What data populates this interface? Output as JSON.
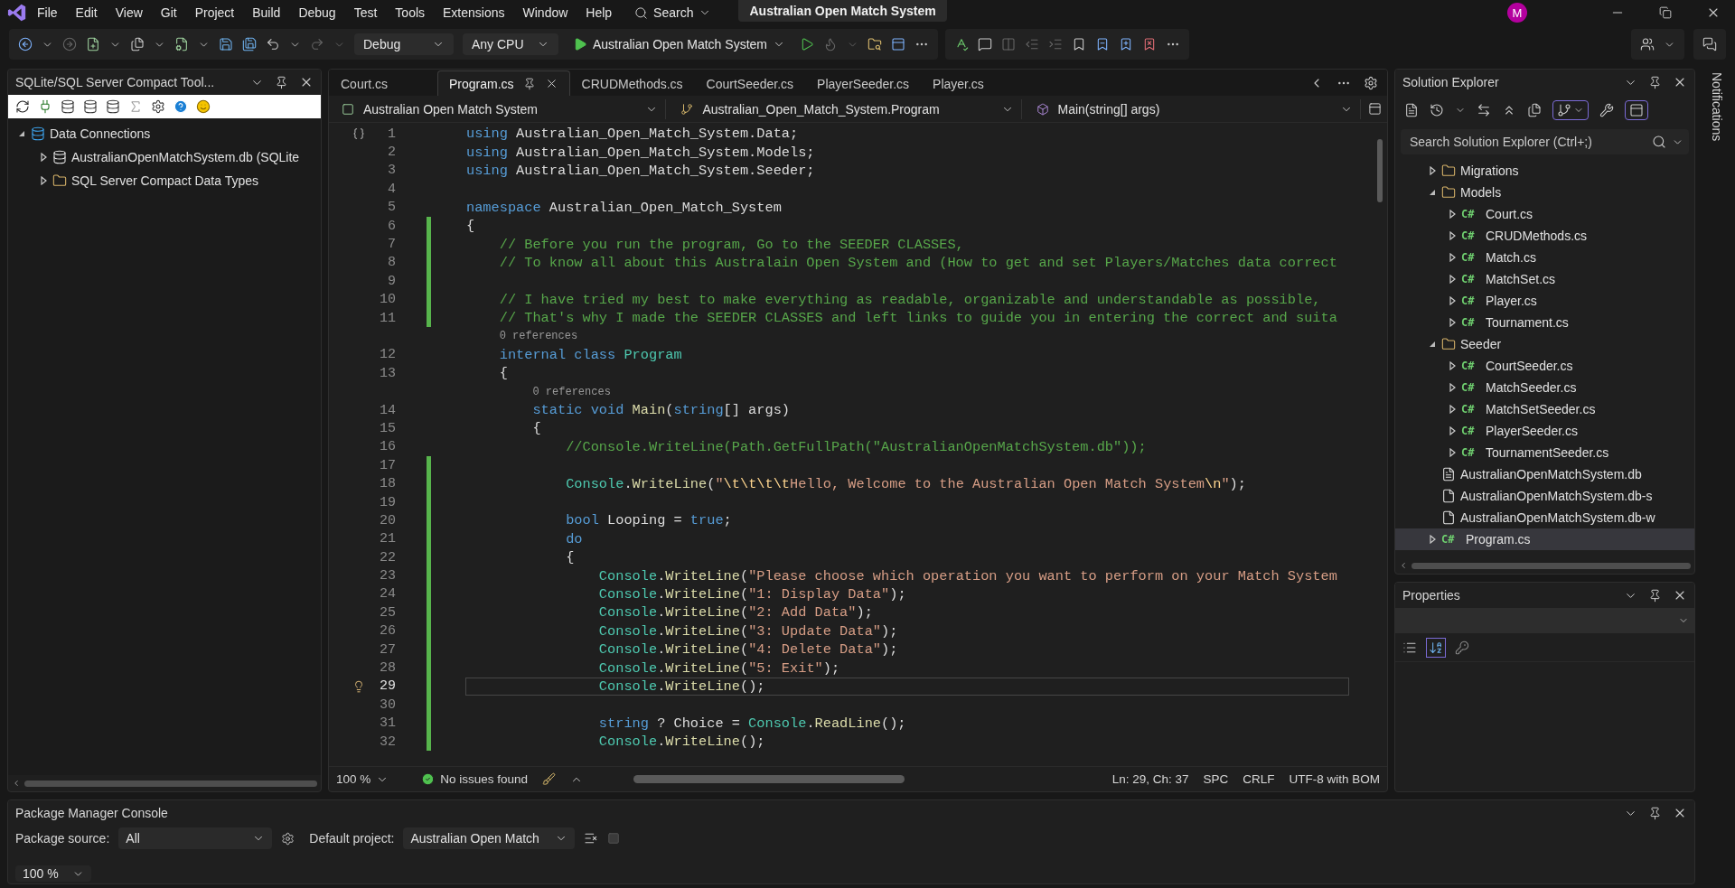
{
  "menu": {
    "items": [
      "File",
      "Edit",
      "View",
      "Git",
      "Project",
      "Build",
      "Debug",
      "Test",
      "Tools",
      "Extensions",
      "Window",
      "Help"
    ],
    "search": "Search",
    "title": "Australian Open Match System",
    "avatar": "M"
  },
  "toolbar": {
    "configuration": "Debug",
    "platform": "Any CPU",
    "startup": "Australian Open Match System"
  },
  "left_panel": {
    "title": "SQLite/SQL Server Compact Tool...",
    "tree": [
      {
        "label": "Data Connections",
        "kind": "connections",
        "expanded": true,
        "children": [
          {
            "label": "AustralianOpenMatchSystem.db (SQLite",
            "kind": "database",
            "expanded": false
          },
          {
            "label": "SQL Server Compact Data Types",
            "kind": "folder",
            "expanded": false
          }
        ]
      }
    ]
  },
  "editor": {
    "tabs": [
      {
        "label": "Court.cs",
        "selected": false
      },
      {
        "label": "Program.cs",
        "selected": true
      },
      {
        "label": "CRUDMethods.cs",
        "selected": false
      },
      {
        "label": "CourtSeeder.cs",
        "selected": false
      },
      {
        "label": "PlayerSeeder.cs",
        "selected": false
      },
      {
        "label": "Player.cs",
        "selected": false
      }
    ],
    "nav": [
      "Australian Open Match System",
      "Australian_Open_Match_System.Program",
      "Main(string[] args)"
    ],
    "lines": [
      {
        "kind": "code",
        "number": "1",
        "changed": false,
        "current": false,
        "tokens": [
          {
            "kind": "keyword",
            "text": "using "
          },
          {
            "kind": "plain",
            "text": "Australian_Open_Match_System.Data;"
          }
        ]
      },
      {
        "kind": "code",
        "number": "2",
        "changed": false,
        "current": false,
        "tokens": [
          {
            "kind": "keyword",
            "text": "using "
          },
          {
            "kind": "plain",
            "text": "Australian_Open_Match_System.Models;"
          }
        ]
      },
      {
        "kind": "code",
        "number": "3",
        "changed": false,
        "current": false,
        "tokens": [
          {
            "kind": "keyword",
            "text": "using "
          },
          {
            "kind": "plain",
            "text": "Australian_Open_Match_System.Seeder;"
          }
        ]
      },
      {
        "kind": "code",
        "number": "4",
        "changed": false,
        "current": false
      },
      {
        "kind": "code",
        "number": "5",
        "changed": false,
        "current": false,
        "tokens": [
          {
            "kind": "keyword",
            "text": "namespace "
          },
          {
            "kind": "plain",
            "text": "Australian_Open_Match_System"
          }
        ]
      },
      {
        "kind": "code",
        "number": "6",
        "changed": true,
        "current": false,
        "tokens": [
          {
            "kind": "plain",
            "text": "{"
          }
        ]
      },
      {
        "kind": "code",
        "number": "7",
        "changed": true,
        "current": false,
        "tokens": [
          {
            "kind": "comment",
            "text": "    // Before you run the program, Go to the SEEDER CLASSES,"
          }
        ]
      },
      {
        "kind": "code",
        "number": "8",
        "changed": true,
        "current": false,
        "tokens": [
          {
            "kind": "comment",
            "text": "    // To know all about this Australain Open System and (How to get and set Players/Matches data correct"
          }
        ]
      },
      {
        "kind": "code",
        "number": "9",
        "changed": true,
        "current": false
      },
      {
        "kind": "code",
        "number": "10",
        "changed": true,
        "current": false,
        "tokens": [
          {
            "kind": "comment",
            "text": "    // I have tried my best to make everything as readable, organizable and understandable as possible,"
          }
        ]
      },
      {
        "kind": "code",
        "number": "11",
        "changed": true,
        "current": false,
        "tokens": [
          {
            "kind": "comment",
            "text": "    // That's why I made the SEEDER CLASSES and left links to guide you in entering the correct and suita"
          }
        ]
      },
      {
        "kind": "lens",
        "text": "0 references"
      },
      {
        "kind": "code",
        "number": "12",
        "changed": false,
        "current": false,
        "tokens": [
          {
            "kind": "keyword",
            "text": "    internal class "
          },
          {
            "kind": "type",
            "text": "Program"
          }
        ]
      },
      {
        "kind": "code",
        "number": "13",
        "changed": false,
        "current": false,
        "tokens": [
          {
            "kind": "plain",
            "text": "    {"
          }
        ]
      },
      {
        "kind": "lens",
        "text": "0 references"
      },
      {
        "kind": "code",
        "number": "14",
        "changed": false,
        "current": false,
        "tokens": [
          {
            "kind": "keyword",
            "text": "        static void "
          },
          {
            "kind": "method",
            "text": "Main"
          },
          {
            "kind": "plain",
            "text": "("
          },
          {
            "kind": "keyword",
            "text": "string"
          },
          {
            "kind": "plain",
            "text": "[] args)"
          }
        ]
      },
      {
        "kind": "code",
        "number": "15",
        "changed": false,
        "current": false,
        "tokens": [
          {
            "kind": "plain",
            "text": "        {"
          }
        ]
      },
      {
        "kind": "code",
        "number": "16",
        "changed": false,
        "current": false,
        "tokens": [
          {
            "kind": "comment",
            "text": "            //Console.WriteLine(Path.GetFullPath(\"AustralianOpenMatchSystem.db\"));"
          }
        ]
      },
      {
        "kind": "code",
        "number": "17",
        "changed": true,
        "current": false
      },
      {
        "kind": "code",
        "number": "18",
        "changed": true,
        "current": false,
        "tokens": [
          {
            "kind": "type",
            "text": "            Console"
          },
          {
            "kind": "plain",
            "text": "."
          },
          {
            "kind": "method",
            "text": "WriteLine"
          },
          {
            "kind": "plain",
            "text": "("
          },
          {
            "kind": "string",
            "text": "\""
          },
          {
            "kind": "escape",
            "text": "\\t\\t\\t\\t"
          },
          {
            "kind": "string",
            "text": "Hello, Welcome to the Australian Open Match System"
          },
          {
            "kind": "escape",
            "text": "\\n"
          },
          {
            "kind": "string",
            "text": "\""
          },
          {
            "kind": "plain",
            "text": ");"
          }
        ]
      },
      {
        "kind": "code",
        "number": "19",
        "changed": true,
        "current": false
      },
      {
        "kind": "code",
        "number": "20",
        "changed": true,
        "current": false,
        "tokens": [
          {
            "kind": "keyword",
            "text": "            bool "
          },
          {
            "kind": "plain",
            "text": "Looping = "
          },
          {
            "kind": "keyword",
            "text": "true"
          },
          {
            "kind": "plain",
            "text": ";"
          }
        ]
      },
      {
        "kind": "code",
        "number": "21",
        "changed": true,
        "current": false,
        "tokens": [
          {
            "kind": "keyword",
            "text": "            do"
          }
        ]
      },
      {
        "kind": "code",
        "number": "22",
        "changed": true,
        "current": false,
        "tokens": [
          {
            "kind": "plain",
            "text": "            {"
          }
        ]
      },
      {
        "kind": "code",
        "number": "23",
        "changed": true,
        "current": false,
        "tokens": [
          {
            "kind": "type",
            "text": "                Console"
          },
          {
            "kind": "plain",
            "text": "."
          },
          {
            "kind": "method",
            "text": "WriteLine"
          },
          {
            "kind": "plain",
            "text": "("
          },
          {
            "kind": "string",
            "text": "\"Please choose which operation you want to perform on your Match System"
          }
        ]
      },
      {
        "kind": "code",
        "number": "24",
        "changed": true,
        "current": false,
        "tokens": [
          {
            "kind": "type",
            "text": "                Console"
          },
          {
            "kind": "plain",
            "text": "."
          },
          {
            "kind": "method",
            "text": "WriteLine"
          },
          {
            "kind": "plain",
            "text": "("
          },
          {
            "kind": "string",
            "text": "\"1: Display Data\""
          },
          {
            "kind": "plain",
            "text": ");"
          }
        ]
      },
      {
        "kind": "code",
        "number": "25",
        "changed": true,
        "current": false,
        "tokens": [
          {
            "kind": "type",
            "text": "                Console"
          },
          {
            "kind": "plain",
            "text": "."
          },
          {
            "kind": "method",
            "text": "WriteLine"
          },
          {
            "kind": "plain",
            "text": "("
          },
          {
            "kind": "string",
            "text": "\"2: Add Data\""
          },
          {
            "kind": "plain",
            "text": ");"
          }
        ]
      },
      {
        "kind": "code",
        "number": "26",
        "changed": true,
        "current": false,
        "tokens": [
          {
            "kind": "type",
            "text": "                Console"
          },
          {
            "kind": "plain",
            "text": "."
          },
          {
            "kind": "method",
            "text": "WriteLine"
          },
          {
            "kind": "plain",
            "text": "("
          },
          {
            "kind": "string",
            "text": "\"3: Update Data\""
          },
          {
            "kind": "plain",
            "text": ");"
          }
        ]
      },
      {
        "kind": "code",
        "number": "27",
        "changed": true,
        "current": false,
        "tokens": [
          {
            "kind": "type",
            "text": "                Console"
          },
          {
            "kind": "plain",
            "text": "."
          },
          {
            "kind": "method",
            "text": "WriteLine"
          },
          {
            "kind": "plain",
            "text": "("
          },
          {
            "kind": "string",
            "text": "\"4: Delete Data\""
          },
          {
            "kind": "plain",
            "text": ");"
          }
        ]
      },
      {
        "kind": "code",
        "number": "28",
        "changed": true,
        "current": false,
        "tokens": [
          {
            "kind": "type",
            "text": "                Console"
          },
          {
            "kind": "plain",
            "text": "."
          },
          {
            "kind": "method",
            "text": "WriteLine"
          },
          {
            "kind": "plain",
            "text": "("
          },
          {
            "kind": "string",
            "text": "\"5: Exit\""
          },
          {
            "kind": "plain",
            "text": ");"
          }
        ]
      },
      {
        "kind": "code",
        "number": "29",
        "changed": true,
        "current": true,
        "tokens": [
          {
            "kind": "type",
            "text": "                Console"
          },
          {
            "kind": "plain",
            "text": "."
          },
          {
            "kind": "method",
            "text": "WriteLine"
          },
          {
            "kind": "plain",
            "text": "();"
          }
        ]
      },
      {
        "kind": "code",
        "number": "30",
        "changed": true,
        "current": false
      },
      {
        "kind": "code",
        "number": "31",
        "changed": true,
        "current": false,
        "tokens": [
          {
            "kind": "keyword",
            "text": "                string"
          },
          {
            "kind": "plain",
            "text": " ? Choice = "
          },
          {
            "kind": "type",
            "text": "Console"
          },
          {
            "kind": "plain",
            "text": "."
          },
          {
            "kind": "method",
            "text": "ReadLine"
          },
          {
            "kind": "plain",
            "text": "();"
          }
        ]
      },
      {
        "kind": "code",
        "number": "32",
        "changed": true,
        "current": false,
        "tokens": [
          {
            "kind": "type",
            "text": "                Console"
          },
          {
            "kind": "plain",
            "text": "."
          },
          {
            "kind": "method",
            "text": "WriteLine"
          },
          {
            "kind": "plain",
            "text": "();"
          }
        ]
      }
    ],
    "status": {
      "zoom": "100 %",
      "issues": "No issues found",
      "position": "Ln: 29, Ch: 37",
      "indent": "SPC",
      "line_endings": "CRLF",
      "encoding": "UTF-8 with BOM"
    }
  },
  "solution_explorer": {
    "title": "Solution Explorer",
    "search": {
      "placeholder": "Search Solution Explorer (Ctrl+;)"
    },
    "tree": [
      {
        "label": "Migrations",
        "kind": "folder",
        "expanded": false,
        "selected": false
      },
      {
        "label": "Models",
        "kind": "folder",
        "expanded": true,
        "selected": false,
        "children": [
          {
            "label": "Court.cs",
            "kind": "csharp",
            "badge": "C#",
            "expanded": false,
            "selected": false
          },
          {
            "label": "CRUDMethods.cs",
            "kind": "csharp",
            "badge": "C#",
            "expanded": false,
            "selected": false
          },
          {
            "label": "Match.cs",
            "kind": "csharp",
            "badge": "C#",
            "expanded": false,
            "selected": false
          },
          {
            "label": "MatchSet.cs",
            "kind": "csharp",
            "badge": "C#",
            "expanded": false,
            "selected": false
          },
          {
            "label": "Player.cs",
            "kind": "csharp",
            "badge": "C#",
            "expanded": false,
            "selected": false
          },
          {
            "label": "Tournament.cs",
            "kind": "csharp",
            "badge": "C#",
            "expanded": false,
            "selected": false
          }
        ]
      },
      {
        "label": "Seeder",
        "kind": "folder",
        "expanded": true,
        "selected": false,
        "children": [
          {
            "label": "CourtSeeder.cs",
            "kind": "csharp",
            "badge": "C#",
            "expanded": false,
            "selected": false
          },
          {
            "label": "MatchSeeder.cs",
            "kind": "csharp",
            "badge": "C#",
            "expanded": false,
            "selected": false
          },
          {
            "label": "MatchSetSeeder.cs",
            "kind": "csharp",
            "badge": "C#",
            "expanded": false,
            "selected": false
          },
          {
            "label": "PlayerSeeder.cs",
            "kind": "csharp",
            "badge": "C#",
            "expanded": false,
            "selected": false
          },
          {
            "label": "TournamentSeeder.cs",
            "kind": "csharp",
            "badge": "C#",
            "expanded": false,
            "selected": false
          }
        ]
      },
      {
        "label": "AustralianOpenMatchSystem.db",
        "kind": "dbfile",
        "selected": false
      },
      {
        "label": "AustralianOpenMatchSystem.db-s",
        "kind": "file",
        "selected": false
      },
      {
        "label": "AustralianOpenMatchSystem.db-w",
        "kind": "file",
        "selected": false
      },
      {
        "label": "Program.cs",
        "kind": "csharp",
        "badge": "C#",
        "expanded": false,
        "selected": true
      }
    ]
  },
  "properties": {
    "title": "Properties"
  },
  "notifications": {
    "label": "Notifications"
  },
  "package_console": {
    "title": "Package Manager Console",
    "source_label": "Package source:",
    "source": "All",
    "project_label": "Default project:",
    "project": "Australian Open Match",
    "zoom": "100 %"
  }
}
